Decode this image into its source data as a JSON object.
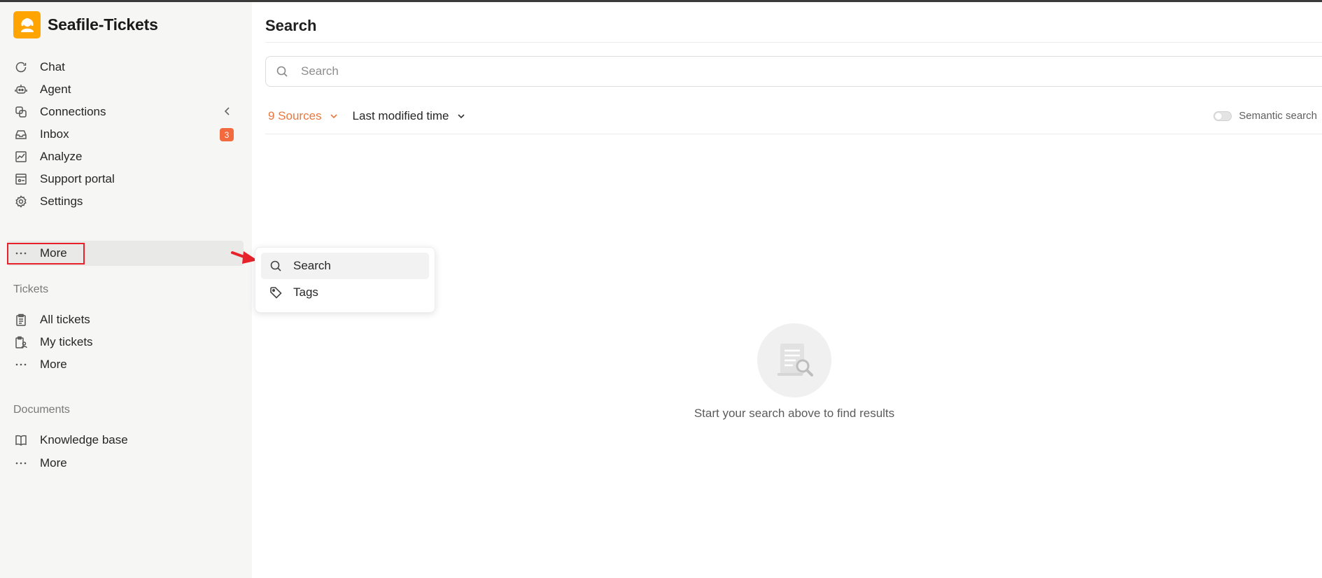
{
  "app": {
    "name": "Seafile-Tickets"
  },
  "sidebar": {
    "nav": [
      {
        "label": "Chat",
        "icon": "chat-icon"
      },
      {
        "label": "Agent",
        "icon": "robot-icon"
      },
      {
        "label": "Connections",
        "icon": "connections-icon"
      },
      {
        "label": "Inbox",
        "icon": "inbox-icon",
        "badge": "3"
      },
      {
        "label": "Analyze",
        "icon": "chart-icon"
      },
      {
        "label": "Support portal",
        "icon": "portal-icon"
      },
      {
        "label": "Settings",
        "icon": "gear-icon"
      },
      {
        "label": "More",
        "icon": "dots-icon"
      }
    ],
    "tickets_section": {
      "title": "Tickets",
      "items": [
        {
          "label": "All tickets",
          "icon": "clipboard-icon"
        },
        {
          "label": "My tickets",
          "icon": "user-clipboard-icon"
        },
        {
          "label": "More",
          "icon": "dots-icon"
        }
      ]
    },
    "documents_section": {
      "title": "Documents",
      "items": [
        {
          "label": "Knowledge base",
          "icon": "book-icon"
        },
        {
          "label": "More",
          "icon": "dots-icon"
        }
      ]
    }
  },
  "main": {
    "title": "Search",
    "search": {
      "placeholder": "Search"
    },
    "filters": {
      "sources_label": "9 Sources",
      "time_label": "Last modified time"
    },
    "semantic_search_label": "Semantic search",
    "semantic_search_enabled": false,
    "empty_state": "Start your search above to find results"
  },
  "popup_menu": {
    "items": [
      {
        "label": "Search",
        "icon": "search-icon"
      },
      {
        "label": "Tags",
        "icon": "tag-icon"
      }
    ]
  },
  "colors": {
    "brand": "#ffa400",
    "accent": "#e9773e",
    "badge": "#f26a3d",
    "highlight": "#e8222a"
  }
}
